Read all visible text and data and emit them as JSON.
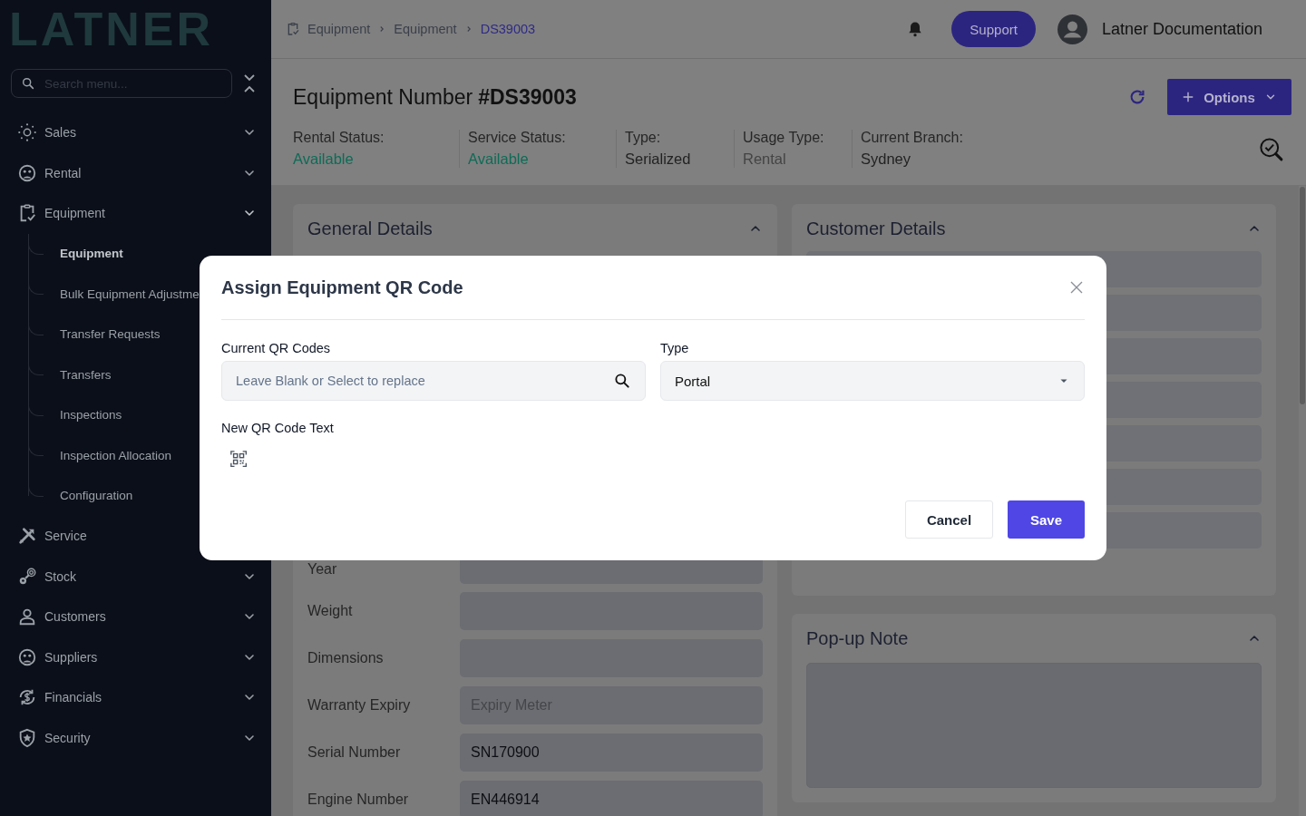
{
  "sidebar": {
    "logo": "LATNER",
    "search": {
      "placeholder": "Search menu..."
    },
    "items": [
      {
        "label": "Sales",
        "expanded": false
      },
      {
        "label": "Rental",
        "expanded": false
      },
      {
        "label": "Equipment",
        "expanded": true,
        "children": [
          {
            "label": "Equipment",
            "selected": true
          },
          {
            "label": "Bulk Equipment Adjustme",
            "selected": false
          },
          {
            "label": "Transfer Requests",
            "selected": false
          },
          {
            "label": "Transfers",
            "selected": false
          },
          {
            "label": "Inspections",
            "selected": false
          },
          {
            "label": "Inspection Allocation",
            "selected": false
          },
          {
            "label": "Configuration",
            "selected": false
          }
        ]
      },
      {
        "label": "Service"
      },
      {
        "label": "Stock",
        "expanded": false
      },
      {
        "label": "Customers",
        "expanded": false
      },
      {
        "label": "Suppliers",
        "expanded": false
      },
      {
        "label": "Financials",
        "expanded": false
      },
      {
        "label": "Security",
        "expanded": false
      }
    ]
  },
  "topbar": {
    "breadcrumb": [
      {
        "label": "Equipment",
        "current": false
      },
      {
        "label": "Equipment",
        "current": false
      },
      {
        "label": "DS39003",
        "current": true
      }
    ],
    "support": "Support",
    "user": "Latner Documentation"
  },
  "header": {
    "title": "Equipment Number",
    "number": "#DS39003",
    "options": "Options",
    "statuses": [
      {
        "label": "Rental Status:",
        "value": "Available",
        "color": "#0e6b56"
      },
      {
        "label": "Service Status:",
        "value": "Available",
        "color": "#0e6b56"
      },
      {
        "label": "Type:",
        "value": "Serialized",
        "color": "#222222"
      },
      {
        "label": "Usage Type:",
        "value": "Rental",
        "color": "#444444"
      },
      {
        "label": "Current Branch:",
        "value": "Sydney",
        "color": "#222222"
      }
    ]
  },
  "general_details": {
    "title": "General Details",
    "expanded": true,
    "fields": [
      {
        "label": "Year"
      },
      {
        "label": "Weight"
      },
      {
        "label": "Dimensions"
      },
      {
        "label": "Warranty Expiry",
        "placeholder": "Expiry Meter"
      },
      {
        "label": "Serial Number",
        "value": "SN170900"
      },
      {
        "label": "Engine Number",
        "value": "EN446914"
      }
    ]
  },
  "customer_details": {
    "title": "Customer Details",
    "expanded": true
  },
  "popup_note": {
    "title": "Pop-up Note",
    "expanded": true
  },
  "modal": {
    "title": "Assign Equipment QR Code",
    "fields": [
      {
        "kind": "search",
        "label": "Current QR Codes",
        "placeholder": "Leave Blank or Select to replace"
      },
      {
        "kind": "select",
        "label": "Type",
        "value": "Portal"
      }
    ],
    "new_qr_label": "New QR Code Text",
    "buttons": [
      {
        "kind": "secondary",
        "label": "Cancel"
      },
      {
        "kind": "primary",
        "label": "Save"
      }
    ]
  }
}
